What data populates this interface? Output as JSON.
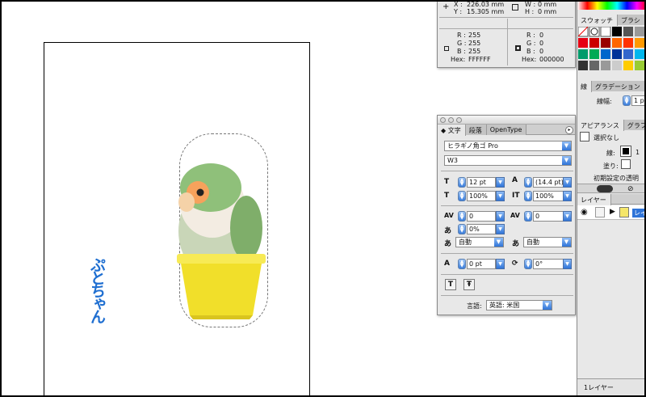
{
  "info_panel": {
    "x_label": "X :",
    "x_value": "226.03 mm",
    "y_label": "Y :",
    "y_value": "15.305 mm",
    "w_label": "W :",
    "w_value": "0 mm",
    "h_label": "H :",
    "h_value": "0 mm",
    "fill": {
      "r_label": "R :",
      "r": "255",
      "g_label": "G :",
      "g": "255",
      "b_label": "B :",
      "b": "255",
      "hex_label": "Hex:",
      "hex": "FFFFFF"
    },
    "stroke": {
      "r_label": "R :",
      "r": "0",
      "g_label": "G :",
      "g": "0",
      "b_label": "B :",
      "b": "0",
      "hex_label": "Hex:",
      "hex": "000000"
    }
  },
  "character_panel": {
    "tabs": [
      {
        "label": "◆ 文字"
      },
      {
        "label": "段落"
      },
      {
        "label": "OpenType"
      }
    ],
    "font_family": "ヒラギノ角ゴ Pro",
    "font_style": "W3",
    "font_size": "12 pt",
    "leading": "(14.4 pt)",
    "horizontal_scale": "100%",
    "vertical_scale": "100%",
    "kerning": "0",
    "tracking": "0",
    "tsume": "0%",
    "aki_left": "自動",
    "aki_right": "自動",
    "baseline_shift": "0 pt",
    "rotation": "0°",
    "language_label": "言語:",
    "language_value": "英語: 米国"
  },
  "swatches_panel": {
    "tab_swatch": "スウォッチ",
    "tab_brush": "ブラシ"
  },
  "stroke_panel": {
    "tab_stroke": "線",
    "tab_gradient": "グラデーション",
    "weight_label": "線幅:",
    "weight_value": "1 pt"
  },
  "appearance_panel": {
    "tab_appearance": "アピアランス",
    "tab_graphic": "グラフ",
    "selection": "選択なし",
    "stroke_label": "線:",
    "stroke_value": "1",
    "fill_label": "塗り:",
    "default_transparency": "初期設定の透明"
  },
  "layers_panel": {
    "tab_layers": "レイヤー",
    "layer_name": "レイ",
    "footer": "1レイヤー"
  },
  "artwork": {
    "signature_text": "ぷとちゃん"
  },
  "colors": {
    "accent_blue": "#2f74d8",
    "bird_green": "#9cc98c",
    "pot_yellow": "#f1df2a",
    "signature_blue": "#1f6fd1"
  }
}
